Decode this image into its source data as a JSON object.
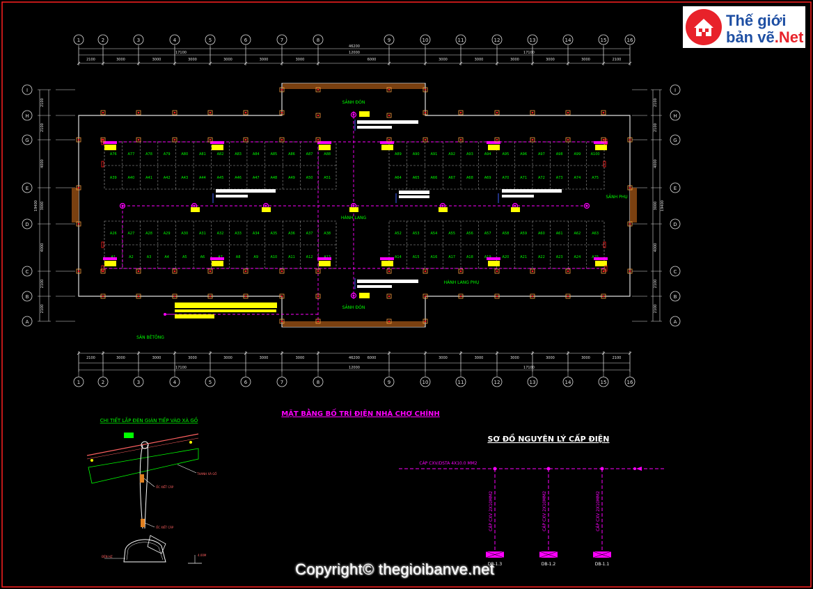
{
  "brand": {
    "line1": "Thế giới",
    "line2a": "bản vẽ",
    "line2b": ".Net"
  },
  "copyright": "Copyright© thegioibanve.net",
  "grid": {
    "cols": [
      "1",
      "2",
      "3",
      "4",
      "5",
      "6",
      "7",
      "8",
      "9",
      "10",
      "11",
      "12",
      "13",
      "14",
      "15",
      "16"
    ],
    "rows": [
      "I",
      "H",
      "G",
      "E",
      "D",
      "C",
      "B",
      "A"
    ]
  },
  "dims": {
    "total": "46200",
    "left": "17100",
    "center": "12000",
    "right": "17100",
    "center_inner": "6000",
    "top_spans": [
      "2100",
      "3000",
      "3000",
      "3000",
      "3000",
      "3000",
      "3000",
      "6000",
      "3000",
      "3000",
      "3000",
      "3000",
      "3000",
      "2100"
    ],
    "side_spans": [
      "2100",
      "2100",
      "4000",
      "3000",
      "4000",
      "2100",
      "2100"
    ],
    "side_total": "19400"
  },
  "labels": {
    "sanh_don_top": "SẢNH ĐÓN",
    "sanh_don_bottom": "SẢNH ĐÓN",
    "hanh_lang": "HÀNH LANG",
    "hanh_lang_phu": "HÀNH LANG PHỤ",
    "sanh_phu": "SẢNH PHỤ",
    "san_be_tong": "SÂN BÊTÔNG"
  },
  "stalls": {
    "r1_left": [
      "A76",
      "A77",
      "A78",
      "A79",
      "A80",
      "A81",
      "A82",
      "A83",
      "A84",
      "A85",
      "A86",
      "A87",
      "A88"
    ],
    "r1_right": [
      "A89",
      "A90",
      "A91",
      "A92",
      "A93",
      "A94",
      "A95",
      "A96",
      "A97",
      "A98",
      "A99",
      "A100"
    ],
    "r2_left": [
      "A39",
      "A40",
      "A41",
      "A42",
      "A43",
      "A44",
      "A45",
      "A46",
      "A47",
      "A48",
      "A49",
      "A50",
      "A51"
    ],
    "r2_right": [
      "A64",
      "A65",
      "A66",
      "A67",
      "A68",
      "A69",
      "A70",
      "A71",
      "A72",
      "A73",
      "A74",
      "A75"
    ],
    "r3_left": [
      "A26",
      "A27",
      "A28",
      "A29",
      "A30",
      "A31",
      "A32",
      "A33",
      "A34",
      "A35",
      "A36",
      "A37",
      "A38"
    ],
    "r3_right": [
      "A52",
      "A53",
      "A54",
      "A55",
      "A56",
      "A57",
      "A58",
      "A59",
      "A60",
      "A61",
      "A62",
      "A63"
    ],
    "r4_left": [
      "A1",
      "A2",
      "A3",
      "A4",
      "A5",
      "A6",
      "A7",
      "A8",
      "A9",
      "A10",
      "A11",
      "A12",
      "A13"
    ],
    "r4_right": [
      "A14",
      "A15",
      "A16",
      "A17",
      "A18",
      "A19",
      "A20",
      "A21",
      "A22",
      "A23",
      "A24",
      "A25"
    ]
  },
  "titles": {
    "plan": "MẶT BẰNG BỐ TRÍ ĐIỆN NHÀ CHỢ CHÍNH",
    "detail": "CHI TIẾT LẮP ĐÈN GIÁN TIẾP VÀO XÀ GỒ",
    "schematic": "SƠ ĐỒ NGUYÊN LÝ CẤP ĐIỆN"
  },
  "detail_notes": {
    "n1": "THANH XÀ GỒ",
    "n2": "ỐC XIẾT CÁP",
    "n3": "ỐC XIẾT CÁP",
    "n4": "ĐÈN HZ",
    "n5": "4.00M"
  },
  "schematic": {
    "main_cable": "CÁP CXV/DSTA 4X10.0 MM2",
    "branches": [
      {
        "cable": "CÁP CXV 2X10MM2",
        "db": "DB-1.3"
      },
      {
        "cable": "CÁP CXV 2X10MM2",
        "db": "DB-1.2"
      },
      {
        "cable": "CÁP CXV 2X10MM2",
        "db": "DB-1.1"
      }
    ]
  },
  "colors": {
    "bg": "#000000",
    "line": "#ffffff",
    "magenta": "#ff00ff",
    "yellow": "#ffff00",
    "green": "#00ff00",
    "red": "#ff2020",
    "brown": "#8b4513",
    "cyan": "#00ffff"
  }
}
